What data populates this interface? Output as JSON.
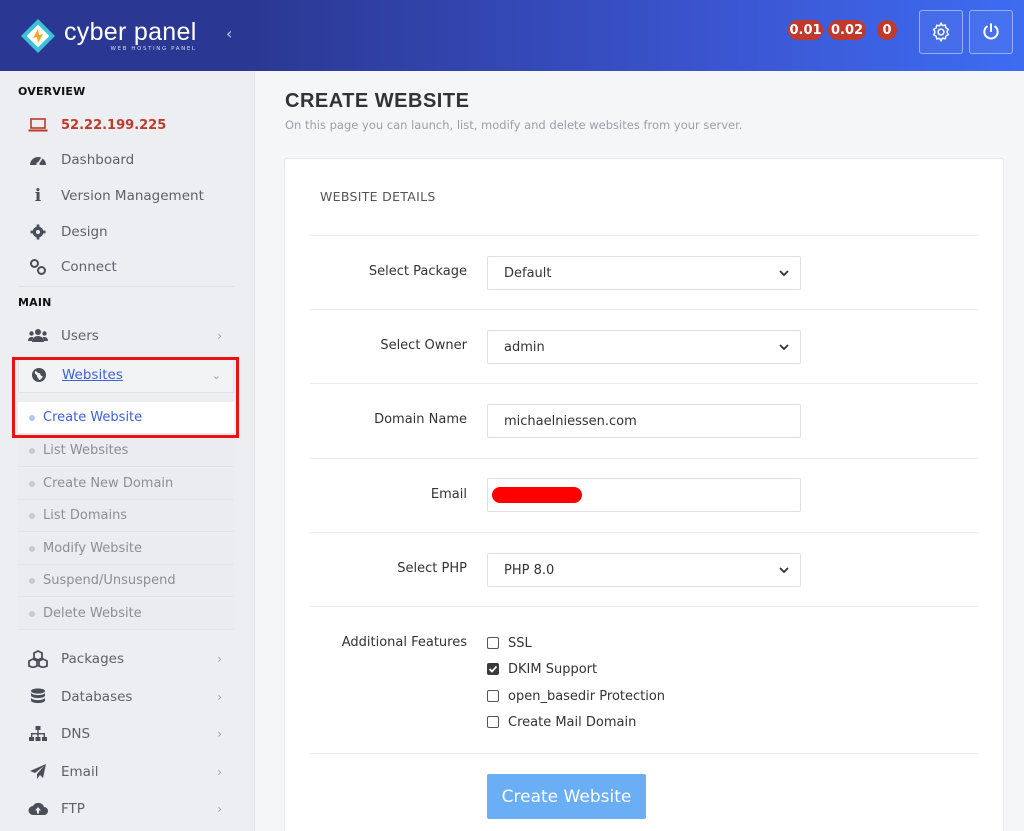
{
  "brand": {
    "name": "cyber panel",
    "tagline": "WEB HOSTING PANEL"
  },
  "header": {
    "load_averages": [
      "0.01",
      "0.02",
      "0"
    ],
    "settings_icon": "gear-icon",
    "power_icon": "power-icon"
  },
  "sidebar": {
    "overview_label": "OVERVIEW",
    "server_ip": "52.22.199.225",
    "overview_items": [
      {
        "label": "Dashboard",
        "icon": "dashboard-icon"
      },
      {
        "label": "Version Management",
        "icon": "info-icon"
      },
      {
        "label": "Design",
        "icon": "cog-icon"
      },
      {
        "label": "Connect",
        "icon": "link-icon"
      }
    ],
    "main_label": "MAIN",
    "users": "Users",
    "websites": "Websites",
    "websites_sub": [
      "Create Website",
      "List Websites",
      "Create New Domain",
      "List Domains",
      "Modify Website",
      "Suspend/Unsuspend",
      "Delete Website"
    ],
    "main_items": [
      {
        "label": "Packages",
        "icon": "packages-icon"
      },
      {
        "label": "Databases",
        "icon": "database-icon"
      },
      {
        "label": "DNS",
        "icon": "sitemap-icon"
      },
      {
        "label": "Email",
        "icon": "paper-plane-icon"
      },
      {
        "label": "FTP",
        "icon": "cloud-upload-icon"
      }
    ]
  },
  "main": {
    "title": "CREATE WEBSITE",
    "subtitle": "On this page you can launch, list, modify and delete websites from your server.",
    "card_title": "WEBSITE DETAILS",
    "form": {
      "package_label": "Select Package",
      "package_value": "Default",
      "owner_label": "Select Owner",
      "owner_value": "admin",
      "domain_label": "Domain Name",
      "domain_value": "michaelniessen.com",
      "email_label": "Email",
      "php_label": "Select PHP",
      "php_value": "PHP 8.0",
      "features_label": "Additional Features",
      "features": [
        {
          "label": "SSL",
          "checked": false
        },
        {
          "label": "DKIM Support",
          "checked": true
        },
        {
          "label": "open_basedir Protection",
          "checked": false
        },
        {
          "label": "Create Mail Domain",
          "checked": false
        }
      ],
      "submit": "Create Website"
    }
  },
  "colors": {
    "sidebar_header": "#2b3893",
    "accent_blue": "#3c62d9",
    "badge_red": "#c0392b",
    "button": "#6aaef6",
    "highlight": "#ee1111"
  }
}
